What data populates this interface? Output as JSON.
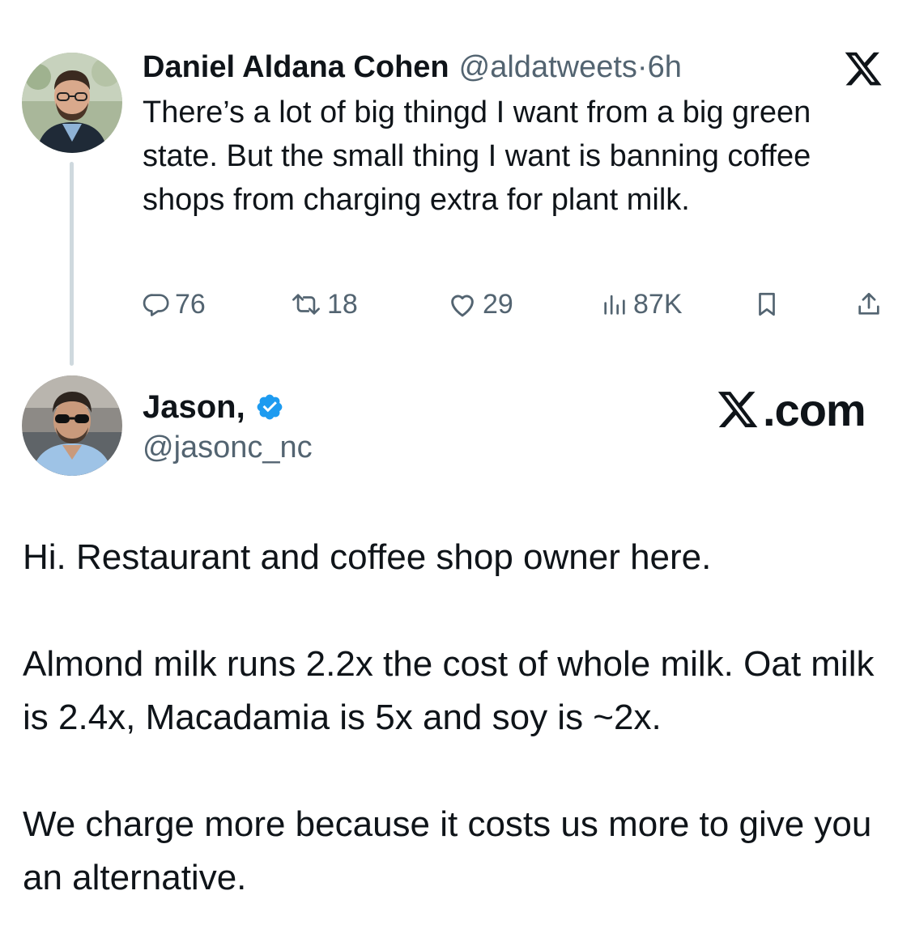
{
  "quoted_tweet": {
    "author_name": "Daniel Aldana Cohen",
    "author_handle": "@aldatweets",
    "separator": "·",
    "time": "6h",
    "text": "There’s a lot of big thingd I want from a big green state. But the small thing I want is banning coffee shops from charging extra for plant milk.",
    "actions": {
      "replies": "76",
      "reposts": "18",
      "likes": "29",
      "views": "87K"
    },
    "avatar_icon": "avatar-photo-daniel"
  },
  "reply_tweet": {
    "author_name": "Jason,",
    "author_handle": "@jasonc_nc",
    "verified": true,
    "avatar_icon": "avatar-photo-jason",
    "paragraphs": [
      "Hi. Restaurant and coffee shop owner here.",
      "Almond milk runs 2.2x the cost of whole milk. Oat milk is 2.4x, Macadamia is 5x and soy is ~2x.",
      "We charge more because it costs us more to give you an alternative."
    ]
  },
  "branding": {
    "site_text": ".com",
    "logo_icon": "x-logo-icon"
  },
  "colors": {
    "text": "#0f1419",
    "secondary": "#536471",
    "verified_blue": "#1d9bf0",
    "thread_line": "#cfd9de"
  }
}
